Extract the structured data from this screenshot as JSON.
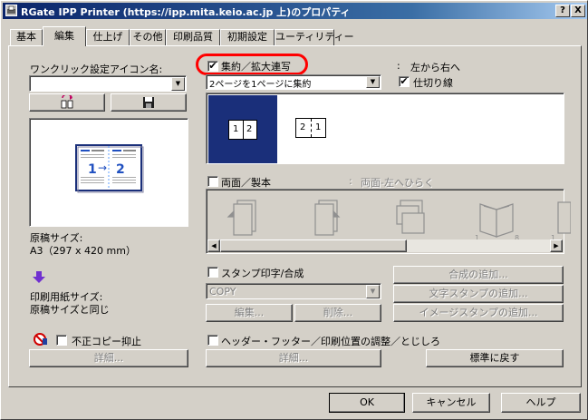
{
  "window": {
    "title": "RGate IPP Printer (https://ipp.mita.keio.ac.jp 上)のプロパティ",
    "help_btn": "?",
    "close_btn": "X"
  },
  "tabs": [
    "基本",
    "編集",
    "仕上げ",
    "その他",
    "印刷品質",
    "初期設定",
    "ユーティリティー"
  ],
  "left": {
    "oneclick_label": "ワンクリック設定アイコン名:",
    "oneclick_value": "",
    "original_size_label": "原稿サイズ:",
    "original_size_value": "A3（297 x 420 mm）",
    "paper_size_label": "印刷用紙サイズ:",
    "paper_size_value": "原稿サイズと同じ",
    "copy_protect_label": "不正コピー抑止",
    "detail_btn": "詳細..."
  },
  "combine": {
    "checkbox_label": "集約／拡大連写",
    "checked": true,
    "colon": ":",
    "order_value": "左から右へ",
    "mode_value": "2ページを1ページに集約",
    "divider_label": "仕切り線",
    "divider_checked": true,
    "preview_a_left": "1",
    "preview_a_right": "2",
    "preview_b_left": "2",
    "preview_b_right": "1"
  },
  "duplex": {
    "checkbox_label": "両面／製本",
    "checked": false,
    "colon": ":",
    "value": "両面-左へひらく",
    "icon_labels": [
      "1",
      "8",
      "1",
      "8"
    ]
  },
  "stamp": {
    "checkbox_label": "スタンプ印字/合成",
    "checked": false,
    "select_value": "COPY",
    "edit_btn": "編集...",
    "delete_btn": "削除...",
    "add_overlay_btn": "合成の追加...",
    "add_text_stamp_btn": "文字スタンプの追加...",
    "add_image_stamp_btn": "イメージスタンプの追加..."
  },
  "header_footer": {
    "checkbox_label": "ヘッダー・フッター／印刷位置の調整／とじしろ",
    "checked": false,
    "detail_btn": "詳細..."
  },
  "reset_btn": "標準に戻す",
  "footer": {
    "ok": "OK",
    "cancel": "キャンセル",
    "help": "ヘルプ"
  },
  "colors": {
    "accent": "#1a2f7a",
    "highlight_circle": "#ff0000",
    "title_bar": "#0a246a"
  }
}
